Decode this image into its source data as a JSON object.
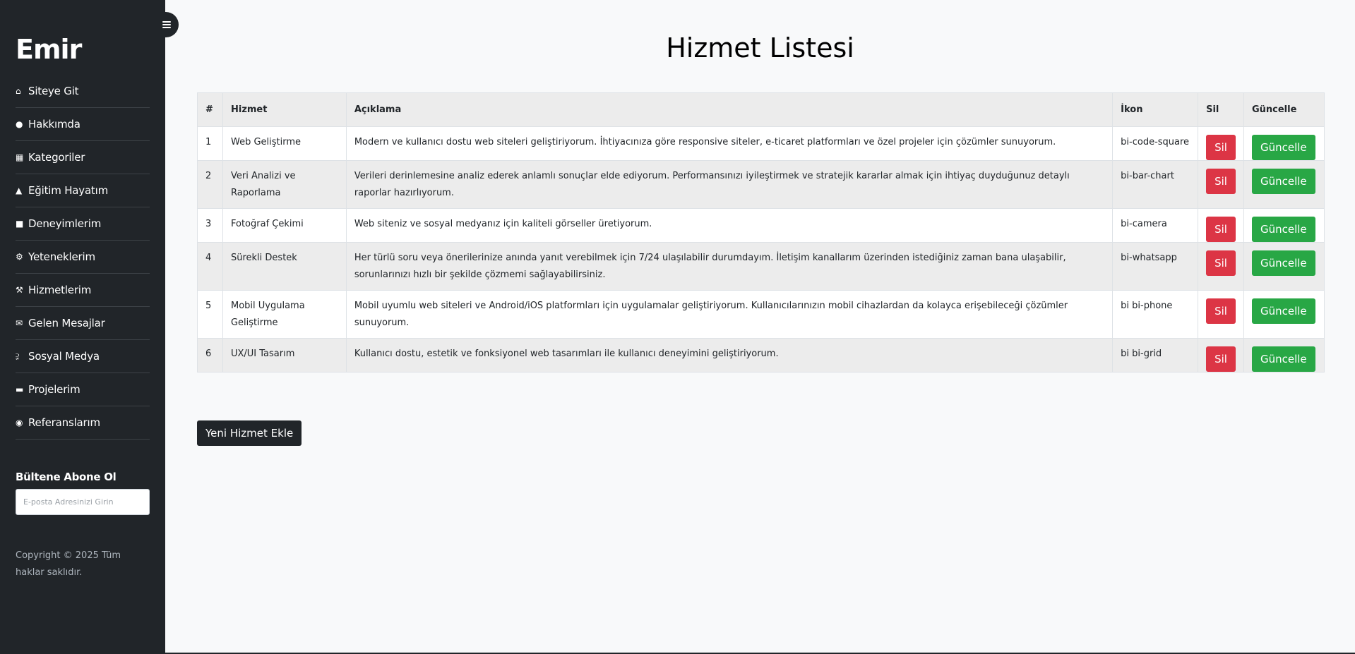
{
  "sidebar": {
    "brand": "Emir",
    "items": [
      {
        "label": "Siteye Git",
        "icon": "home-icon"
      },
      {
        "label": "Hakkımda",
        "icon": "user-icon"
      },
      {
        "label": "Kategoriler",
        "icon": "grid-icon"
      },
      {
        "label": "Eğitim Hayatım",
        "icon": "graduation-cap-icon"
      },
      {
        "label": "Deneyimlerim",
        "icon": "briefcase-icon"
      },
      {
        "label": "Yeteneklerim",
        "icon": "cogs-icon"
      },
      {
        "label": "Hizmetlerim",
        "icon": "wrench-icon"
      },
      {
        "label": "Gelen Mesajlar",
        "icon": "envelope-icon"
      },
      {
        "label": "Sosyal Medya",
        "icon": "share-icon"
      },
      {
        "label": "Projelerim",
        "icon": "folder-icon"
      },
      {
        "label": "Referanslarım",
        "icon": "comment-icon"
      }
    ],
    "newsletter": {
      "title": "Bültene Abone Ol",
      "placeholder": "E-posta Adresinizi Girin"
    },
    "copyright": "Copyright © 2025 Tüm haklar saklıdır."
  },
  "main": {
    "title": "Hizmet Listesi",
    "table": {
      "headers": {
        "num": "#",
        "service": "Hizmet",
        "description": "Açıklama",
        "icon": "İkon",
        "delete": "Sil",
        "update": "Güncelle"
      },
      "rows": [
        {
          "num": "1",
          "service": "Web Geliştirme",
          "description": "Modern ve kullanıcı dostu web siteleri geliştiriyorum. İhtiyacınıza göre responsive siteler, e-ticaret platformları ve özel projeler için çözümler sunuyorum.",
          "icon": "bi-code-square"
        },
        {
          "num": "2",
          "service": "Veri Analizi ve Raporlama",
          "description": "Verileri derinlemesine analiz ederek anlamlı sonuçlar elde ediyorum. Performansınızı iyileştirmek ve stratejik kararlar almak için ihtiyaç duyduğunuz detaylı raporlar hazırlıyorum.",
          "icon": "bi-bar-chart"
        },
        {
          "num": "3",
          "service": "Fotoğraf Çekimi",
          "description": "Web siteniz ve sosyal medyanız için kaliteli görseller üretiyorum.",
          "icon": "bi-camera"
        },
        {
          "num": "4",
          "service": "Sürekli Destek",
          "description": "Her türlü soru veya önerilerinize anında yanıt verebilmek için 7/24 ulaşılabilir durumdayım. İletişim kanallarım üzerinden istediğiniz zaman bana ulaşabilir, sorunlarınızı hızlı bir şekilde çözmemi sağlayabilirsiniz.",
          "icon": "bi-whatsapp"
        },
        {
          "num": "5",
          "service": "Mobil Uygulama Geliştirme",
          "description": "Mobil uyumlu web siteleri ve Android/iOS platformları için uygulamalar geliştiriyorum. Kullanıcılarınızın mobil cihazlardan da kolayca erişebileceği çözümler sunuyorum.",
          "icon": "bi bi-phone"
        },
        {
          "num": "6",
          "service": "UX/UI Tasarım",
          "description": "Kullanıcı dostu, estetik ve fonksiyonel web tasarımları ile kullanıcı deneyimini geliştiriyorum.",
          "icon": "bi bi-grid"
        }
      ],
      "delete_label": "Sil",
      "update_label": "Güncelle"
    },
    "add_button": "Yeni Hizmet Ekle"
  },
  "colors": {
    "sidebar_bg": "#212529",
    "danger": "#dc3545",
    "success": "#28a745"
  }
}
